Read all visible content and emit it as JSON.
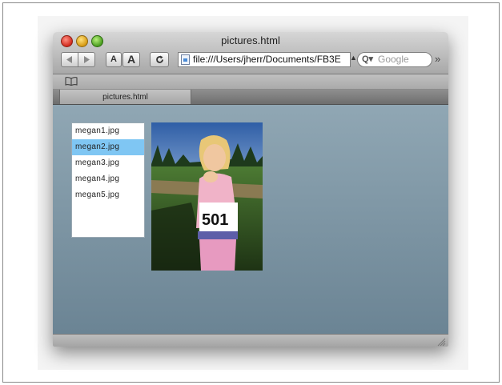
{
  "window": {
    "title": "pictures.html"
  },
  "toolbar": {
    "font_small_label": "A",
    "font_large_label": "A",
    "reload_label": "C",
    "url_value": "file:///Users/jherr/Documents/FB3E",
    "search_placeholder": "Google",
    "overflow_label": "»"
  },
  "tabs": [
    {
      "label": "pictures.html"
    }
  ],
  "file_list": {
    "items": [
      {
        "label": "megan1.jpg"
      },
      {
        "label": "megan2.jpg"
      },
      {
        "label": "megan3.jpg"
      },
      {
        "label": "megan4.jpg"
      },
      {
        "label": "megan5.jpg"
      }
    ],
    "selected_index": 1,
    "selected_color": "#7fc6f3"
  },
  "photo": {
    "bib_number": "501"
  }
}
